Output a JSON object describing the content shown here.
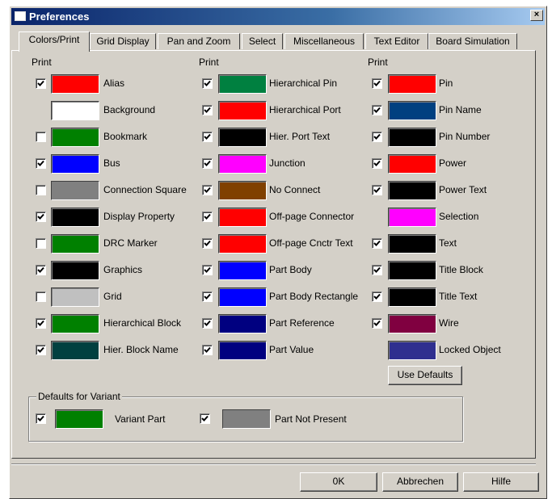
{
  "window": {
    "title": "Preferences",
    "close": "×"
  },
  "tabs": [
    "Colors/Print",
    "Grid Display",
    "Pan and Zoom",
    "Select",
    "Miscellaneous",
    "Text Editor",
    "Board Simulation"
  ],
  "columns": [
    {
      "header": "Print",
      "items": [
        {
          "label": "Alias",
          "checked": true,
          "color": "#ff0000"
        },
        {
          "label": "Background",
          "checked": null,
          "color": "#ffffff"
        },
        {
          "label": "Bookmark",
          "checked": false,
          "color": "#008000"
        },
        {
          "label": "Bus",
          "checked": true,
          "color": "#0000ff"
        },
        {
          "label": "Connection Square",
          "checked": false,
          "color": "#808080"
        },
        {
          "label": "Display Property",
          "checked": true,
          "color": "#000000"
        },
        {
          "label": "DRC Marker",
          "checked": false,
          "color": "#008000"
        },
        {
          "label": "Graphics",
          "checked": true,
          "color": "#000000"
        },
        {
          "label": "Grid",
          "checked": false,
          "color": "#c0c0c0"
        },
        {
          "label": "Hierarchical Block",
          "checked": true,
          "color": "#008000"
        },
        {
          "label": "Hier. Block Name",
          "checked": true,
          "color": "#004040"
        }
      ]
    },
    {
      "header": "Print",
      "items": [
        {
          "label": "Hierarchical Pin",
          "checked": true,
          "color": "#008040"
        },
        {
          "label": "Hierarchical Port",
          "checked": true,
          "color": "#ff0000"
        },
        {
          "label": "Hier. Port Text",
          "checked": true,
          "color": "#000000"
        },
        {
          "label": "Junction",
          "checked": true,
          "color": "#ff00ff"
        },
        {
          "label": "No Connect",
          "checked": true,
          "color": "#804000"
        },
        {
          "label": "Off-page Connector",
          "checked": true,
          "color": "#ff0000"
        },
        {
          "label": "Off-page Cnctr Text",
          "checked": true,
          "color": "#ff0000"
        },
        {
          "label": "Part Body",
          "checked": true,
          "color": "#0000ff"
        },
        {
          "label": "Part Body Rectangle",
          "checked": true,
          "color": "#0000ff"
        },
        {
          "label": "Part Reference",
          "checked": true,
          "color": "#000080"
        },
        {
          "label": "Part Value",
          "checked": true,
          "color": "#000080"
        }
      ]
    },
    {
      "header": "Print",
      "items": [
        {
          "label": "Pin",
          "checked": true,
          "color": "#ff0000"
        },
        {
          "label": "Pin Name",
          "checked": true,
          "color": "#004080"
        },
        {
          "label": "Pin Number",
          "checked": true,
          "color": "#000000"
        },
        {
          "label": "Power",
          "checked": true,
          "color": "#ff0000"
        },
        {
          "label": "Power Text",
          "checked": true,
          "color": "#000000"
        },
        {
          "label": "Selection",
          "checked": null,
          "color": "#ff00ff"
        },
        {
          "label": "Text",
          "checked": true,
          "color": "#000000"
        },
        {
          "label": "Title Block",
          "checked": true,
          "color": "#000000"
        },
        {
          "label": "Title Text",
          "checked": true,
          "color": "#000000"
        },
        {
          "label": "Wire",
          "checked": true,
          "color": "#800040"
        },
        {
          "label": "Locked Object",
          "checked": null,
          "color": "#2f2f8f"
        }
      ]
    }
  ],
  "use_defaults": "Use Defaults",
  "variant": {
    "group_label": "Defaults for Variant",
    "items": [
      {
        "label": "Variant Part",
        "checked": true,
        "color": "#008000"
      },
      {
        "label": "Part Not Present",
        "checked": true,
        "color": "#808080"
      }
    ]
  },
  "buttons": {
    "ok": "0K",
    "cancel": "Abbrechen",
    "help": "Hilfe"
  }
}
